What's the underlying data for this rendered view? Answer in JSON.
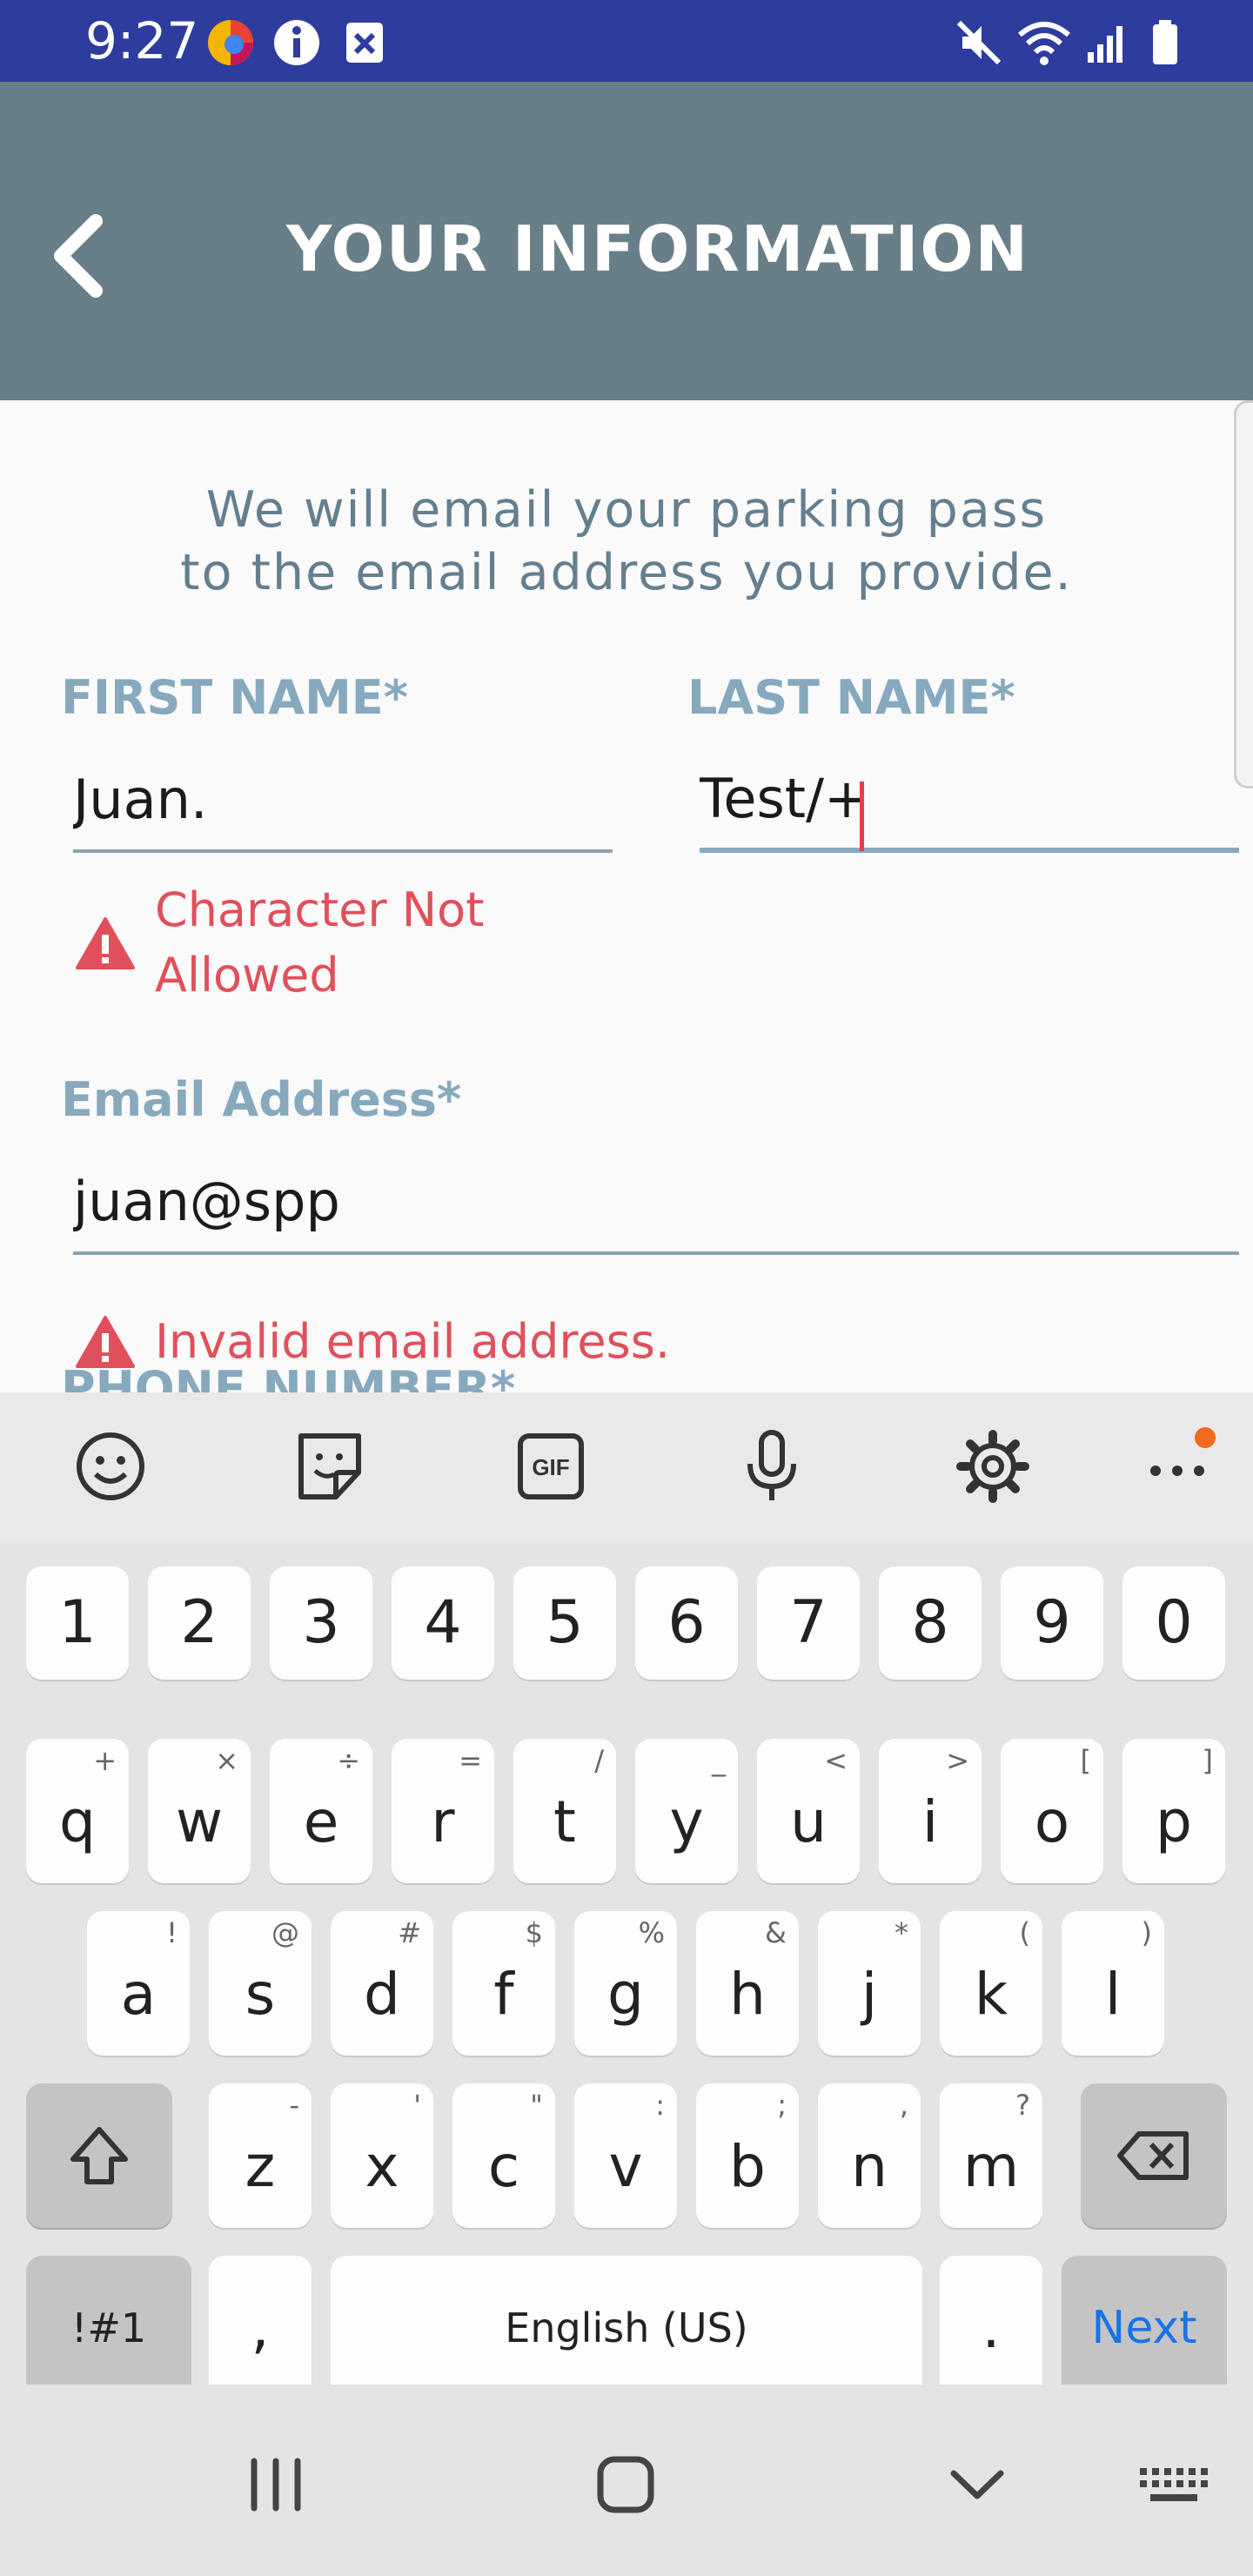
{
  "status_bar": {
    "time": "9:27",
    "background": "#2e3c9e"
  },
  "app_bar": {
    "title": "YOUR INFORMATION",
    "background": "#687f89"
  },
  "form": {
    "intro_line1": "We will email your parking pass",
    "intro_line2": "to the email address you provide.",
    "first_name": {
      "label": "FIRST NAME*",
      "value": "Juan."
    },
    "last_name": {
      "label": "LAST NAME*",
      "value": "Test/+"
    },
    "first_name_error_line1": "Character Not",
    "first_name_error_line2": "Allowed",
    "email": {
      "label": "Email Address*",
      "value": "juan@spp"
    },
    "email_error": "Invalid email address.",
    "phone_label": "PHONE NUMBER*",
    "label_color": "#86a9be",
    "error_color": "#e0505c"
  },
  "keyboard": {
    "number_row": [
      "1",
      "2",
      "3",
      "4",
      "5",
      "6",
      "7",
      "8",
      "9",
      "0"
    ],
    "row1": [
      {
        "k": "q",
        "s": "+"
      },
      {
        "k": "w",
        "s": "×"
      },
      {
        "k": "e",
        "s": "÷"
      },
      {
        "k": "r",
        "s": "="
      },
      {
        "k": "t",
        "s": "/"
      },
      {
        "k": "y",
        "s": "_"
      },
      {
        "k": "u",
        "s": "<"
      },
      {
        "k": "i",
        "s": ">"
      },
      {
        "k": "o",
        "s": "["
      },
      {
        "k": "p",
        "s": "]"
      }
    ],
    "row2": [
      {
        "k": "a",
        "s": "!"
      },
      {
        "k": "s",
        "s": "@"
      },
      {
        "k": "d",
        "s": "#"
      },
      {
        "k": "f",
        "s": "$"
      },
      {
        "k": "g",
        "s": "%"
      },
      {
        "k": "h",
        "s": "&"
      },
      {
        "k": "j",
        "s": "*"
      },
      {
        "k": "k",
        "s": "("
      },
      {
        "k": "l",
        "s": ")"
      }
    ],
    "row3": [
      {
        "k": "z",
        "s": "-"
      },
      {
        "k": "x",
        "s": "'"
      },
      {
        "k": "c",
        "s": "\""
      },
      {
        "k": "v",
        "s": ":"
      },
      {
        "k": "b",
        "s": ";"
      },
      {
        "k": "n",
        "s": ","
      },
      {
        "k": "m",
        "s": "?"
      }
    ],
    "symbols_label": "!#1",
    "comma": ",",
    "space_label": "English (US)",
    "period": ".",
    "next_label": "Next",
    "toolbar_icons": [
      "emoji-icon",
      "sticker-icon",
      "gif-icon",
      "microphone-icon",
      "settings-icon",
      "more-icon"
    ],
    "gif_label": "GIF"
  },
  "nav_bar": {
    "icons": [
      "recents-icon",
      "home-icon",
      "hide-keyboard-icon",
      "keyboard-switch-icon"
    ]
  }
}
